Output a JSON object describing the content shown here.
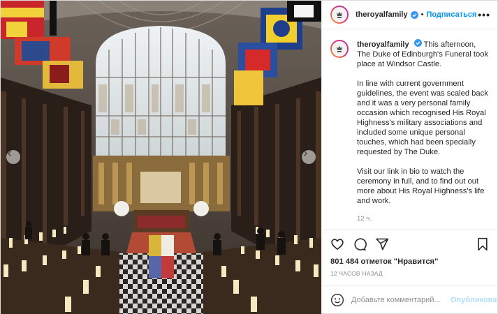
{
  "header": {
    "username": "theroyalfamily",
    "separator": "•",
    "follow_label": "Подписаться",
    "more_label": "•••"
  },
  "caption": {
    "username": "theroyalfamily",
    "paragraphs": [
      "This afternoon, The Duke of Edinburgh's Funeral took place at Windsor Castle.",
      "In line with current government guidelines, the event was scaled back and it was a very personal family occasion which recognised His Royal Highness's military associations and included some unique personal touches, which had been specially requested by The Duke.",
      "Visit our link in bio to watch the ceremony in full, and to find out out more about His Royal Highness's life and work."
    ],
    "time": "12 ч."
  },
  "actions": {
    "icons": [
      "heart-icon",
      "comment-icon",
      "share-icon",
      "bookmark-icon"
    ],
    "likes": "801 484 отметок \"Нравится\"",
    "posted": "12 ЧАСОВ НАЗАД"
  },
  "comment_box": {
    "placeholder": "Добавьте комментарий...",
    "publish_label": "Опубликовать",
    "icon": "emoji-icon"
  },
  "colors": {
    "accent": "#0095f6",
    "publish_disabled": "#b2dffc",
    "verified": "#3897f0",
    "muted": "#8e8e8e"
  }
}
